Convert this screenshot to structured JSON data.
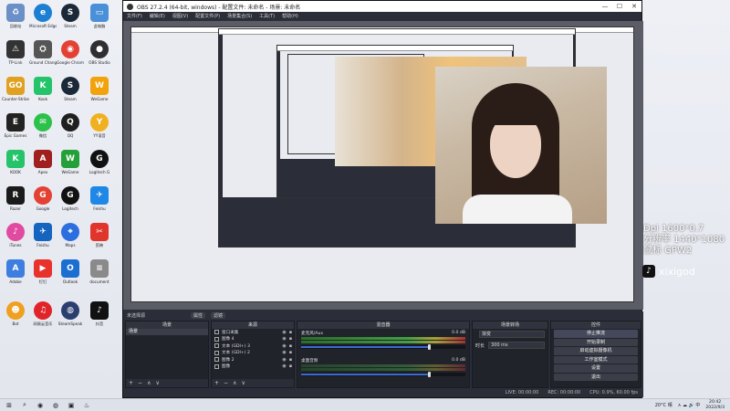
{
  "desktop": {
    "icons": [
      {
        "label": "回收站",
        "glyph": "♻",
        "color": "#6b8fc7",
        "shape": "sq"
      },
      {
        "label": "Microsoft Edge",
        "glyph": "e",
        "color": "#1c7fd1",
        "shape": "round"
      },
      {
        "label": "Steam",
        "glyph": "S",
        "color": "#1b2838",
        "shape": "round"
      },
      {
        "label": "此电脑",
        "glyph": "▭",
        "color": "#4a90d9",
        "shape": "sq"
      },
      {
        "label": "TP-Link",
        "glyph": "⚠",
        "color": "#333333",
        "shape": "sq"
      },
      {
        "label": "Ground Changer",
        "glyph": "⛭",
        "color": "#555555",
        "shape": "sq"
      },
      {
        "label": "Google Chrome",
        "glyph": "◉",
        "color": "#e34133",
        "shape": "round"
      },
      {
        "label": "OBS Studio",
        "glyph": "●",
        "color": "#302e31",
        "shape": "round"
      },
      {
        "label": "Counter-Strike",
        "glyph": "GO",
        "color": "#e0a020",
        "shape": "sq"
      },
      {
        "label": "Kook",
        "glyph": "K",
        "color": "#25c36a",
        "shape": "sq"
      },
      {
        "label": "Steam",
        "glyph": "S",
        "color": "#1b2838",
        "shape": "round"
      },
      {
        "label": "WeGame",
        "glyph": "W",
        "color": "#f2a20b",
        "shape": "sq"
      },
      {
        "label": "Epic Games",
        "glyph": "E",
        "color": "#222222",
        "shape": "sq"
      },
      {
        "label": "微信",
        "glyph": "✉",
        "color": "#2cc14a",
        "shape": "round"
      },
      {
        "label": "QQ",
        "glyph": "Q",
        "color": "#1f1f1f",
        "shape": "round"
      },
      {
        "label": "YY语音",
        "glyph": "Y",
        "color": "#f0b120",
        "shape": "round"
      },
      {
        "label": "KOOK",
        "glyph": "K",
        "color": "#26c36b",
        "shape": "sq"
      },
      {
        "label": "Apex",
        "glyph": "A",
        "color": "#a02020",
        "shape": "sq"
      },
      {
        "label": "WeGame",
        "glyph": "W",
        "color": "#24a03a",
        "shape": "sq"
      },
      {
        "label": "Logitech G",
        "glyph": "G",
        "color": "#111111",
        "shape": "round"
      },
      {
        "label": "Razer",
        "glyph": "R",
        "color": "#1a1a1a",
        "shape": "sq"
      },
      {
        "label": "Google",
        "glyph": "G",
        "color": "#e34133",
        "shape": "round"
      },
      {
        "label": "Logitech",
        "glyph": "G",
        "color": "#111111",
        "shape": "round"
      },
      {
        "label": "Feishu",
        "glyph": "✈",
        "color": "#1f87e5",
        "shape": "sq"
      },
      {
        "label": "iTunes",
        "glyph": "♪",
        "color": "#e04aa0",
        "shape": "round"
      },
      {
        "label": "Feishu",
        "glyph": "✈",
        "color": "#1565c0",
        "shape": "sq"
      },
      {
        "label": "Maps",
        "glyph": "⌖",
        "color": "#2b6ee0",
        "shape": "round"
      },
      {
        "label": "剪映",
        "glyph": "✂",
        "color": "#e0352b",
        "shape": "sq"
      },
      {
        "label": "Adobe",
        "glyph": "A",
        "color": "#3d7ee0",
        "shape": "sq"
      },
      {
        "label": "钉钉",
        "glyph": "▶",
        "color": "#e8322c",
        "shape": "sq"
      },
      {
        "label": "Outlook",
        "glyph": "O",
        "color": "#1c6fd1",
        "shape": "sq"
      },
      {
        "label": "document",
        "glyph": "≡",
        "color": "#8a8a8a",
        "shape": "sq"
      },
      {
        "label": "Bot",
        "glyph": "☻",
        "color": "#f0a020",
        "shape": "round"
      },
      {
        "label": "网易云音乐",
        "glyph": "♫",
        "color": "#e0252a",
        "shape": "round"
      },
      {
        "label": "SteamSpeak",
        "glyph": "◍",
        "color": "#2b3f6e",
        "shape": "round"
      },
      {
        "label": "抖音",
        "glyph": "♪",
        "color": "#111111",
        "shape": "sq"
      }
    ]
  },
  "obs": {
    "title": "OBS 27.2.4 (64-bit, windows) - 配置文件: 未命名 - 场景: 未命名",
    "menu": [
      "文件(F)",
      "编辑(E)",
      "视图(V)",
      "配置文件(P)",
      "场景集合(S)",
      "工具(T)",
      "帮助(H)"
    ],
    "window_buttons": [
      "—",
      "☐",
      "✕"
    ]
  },
  "overlay": {
    "lines": [
      "Dpi 1600*0.7",
      "分辨率 1440*1080",
      "鼠标 GPW2"
    ],
    "tiktok_handle": "xixigod"
  },
  "docks": {
    "tabs": [
      "未选择源",
      "属性",
      "滤镜"
    ],
    "scenes": {
      "title": "场景",
      "items": [
        "场景"
      ]
    },
    "sources": {
      "title": "来源",
      "items": [
        "窗口采集",
        "图像 4",
        "文本 (GDI+) 3",
        "文本 (GDI+) 2",
        "图像 2",
        "图像"
      ]
    },
    "mixer": {
      "title": "混音器",
      "channels": [
        {
          "name": "麦克风/Aux",
          "db": "0.0 dB",
          "level": 0.78
        },
        {
          "name": "桌面音频",
          "db": "0.0 dB",
          "level": 0.78
        }
      ]
    },
    "transitions": {
      "title": "场景转场",
      "fade_label": "渐变",
      "duration_label": "时长",
      "duration_value": "300 ms"
    },
    "controls": {
      "title": "控件",
      "buttons": [
        "停止推流",
        "开始录制",
        "启动虚拟摄像机",
        "工作室模式",
        "设置",
        "退出"
      ]
    },
    "footer_buttons": [
      "+",
      "−",
      "∧",
      "∨"
    ]
  },
  "statusbar": {
    "items": [
      "LIVE: 00:00:00",
      "REC: 00:00:00",
      "CPU: 0.9%, 60.00 fps"
    ]
  },
  "taskbar": {
    "items": [
      "⊞",
      "⌕",
      "◉",
      "◍",
      "▣",
      "♨"
    ],
    "weather": "20°C 晴",
    "tray_text": "∧ ☁ 🔊 中",
    "time": "20:42",
    "date": "2022/9/3"
  }
}
